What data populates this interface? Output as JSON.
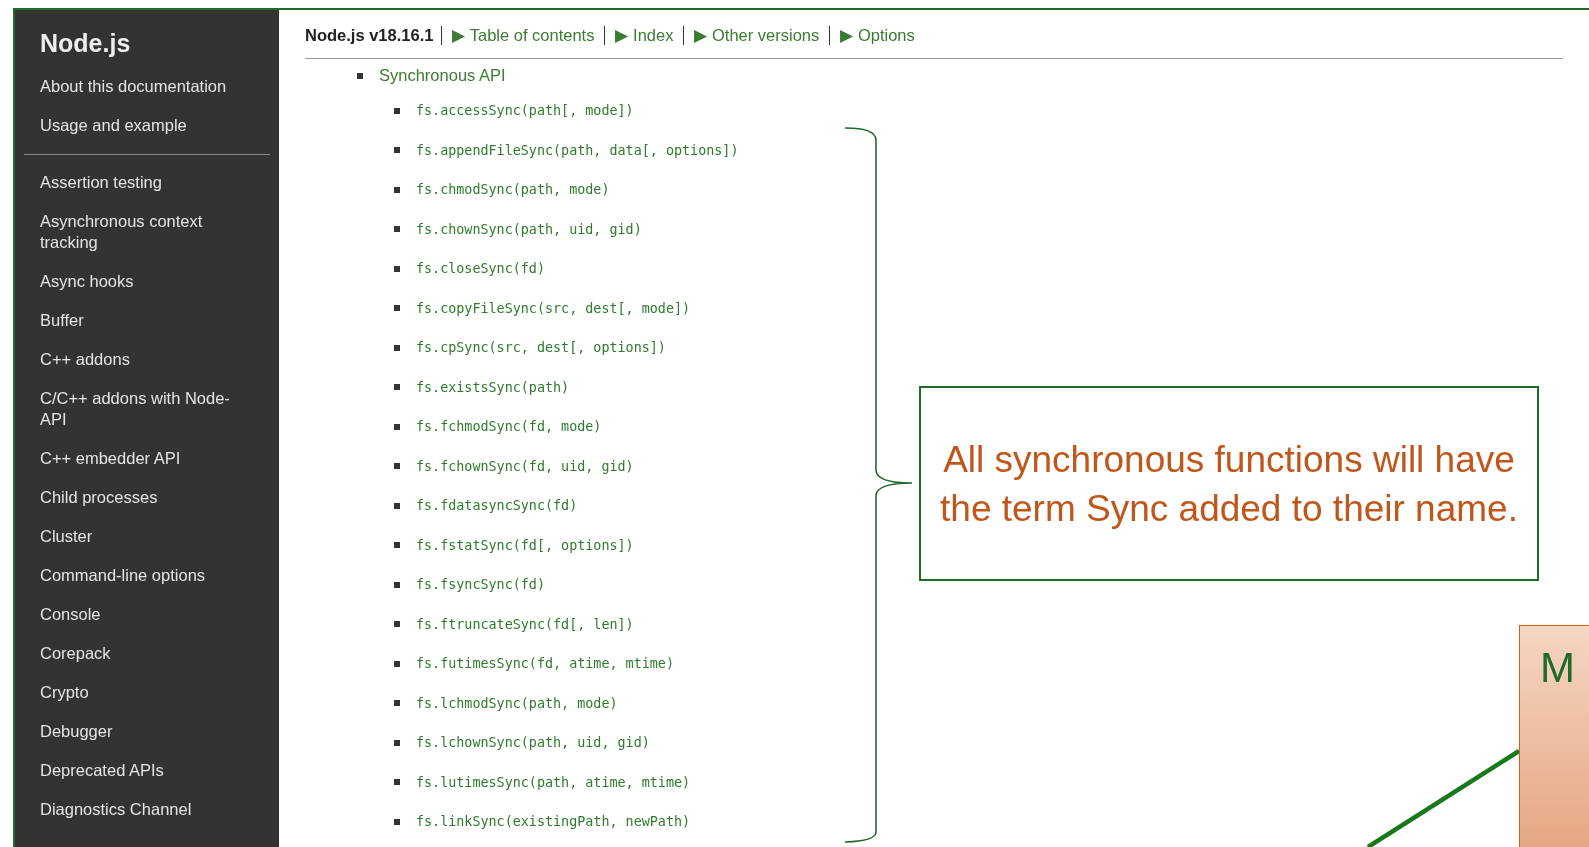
{
  "sidebar": {
    "title": "Node.js",
    "groups": [
      {
        "items": [
          "About this documentation",
          "Usage and example"
        ]
      },
      {
        "items": [
          "Assertion testing",
          "Asynchronous context tracking",
          "Async hooks",
          "Buffer",
          "C++ addons",
          "C/C++ addons with Node-API",
          "C++ embedder API",
          "Child processes",
          "Cluster",
          "Command-line options",
          "Console",
          "Corepack",
          "Crypto",
          "Debugger",
          "Deprecated APIs",
          "Diagnostics Channel"
        ]
      }
    ]
  },
  "header": {
    "version": "Node.js v18.16.1",
    "links": [
      "▶ Table of contents",
      "▶ Index",
      "▶ Other versions",
      "▶ Options"
    ]
  },
  "toc": [
    {
      "label": "Synchronous API",
      "children": [
        {
          "label": "fs.accessSync(path[, mode])"
        },
        {
          "label": "fs.appendFileSync(path, data[, options])"
        },
        {
          "label": "fs.chmodSync(path, mode)"
        },
        {
          "label": "fs.chownSync(path, uid, gid)"
        },
        {
          "label": "fs.closeSync(fd)"
        },
        {
          "label": "fs.copyFileSync(src, dest[, mode])"
        },
        {
          "label": "fs.cpSync(src, dest[, options])"
        },
        {
          "label": "fs.existsSync(path)"
        },
        {
          "label": "fs.fchmodSync(fd, mode)"
        },
        {
          "label": "fs.fchownSync(fd, uid, gid)"
        },
        {
          "label": "fs.fdatasyncSync(fd)"
        },
        {
          "label": "fs.fstatSync(fd[, options])"
        },
        {
          "label": "fs.fsyncSync(fd)"
        },
        {
          "label": "fs.ftruncateSync(fd[, len])"
        },
        {
          "label": "fs.futimesSync(fd, atime, mtime)"
        },
        {
          "label": "fs.lchmodSync(path, mode)"
        },
        {
          "label": "fs.lchownSync(path, uid, gid)"
        },
        {
          "label": "fs.lutimesSync(path, atime, mtime)"
        },
        {
          "label": "fs.linkSync(existingPath, newPath)"
        }
      ]
    }
  ],
  "annotations": {
    "callout": "All synchronous functions will have the term Sync added to their name.",
    "partial_box": "M"
  }
}
